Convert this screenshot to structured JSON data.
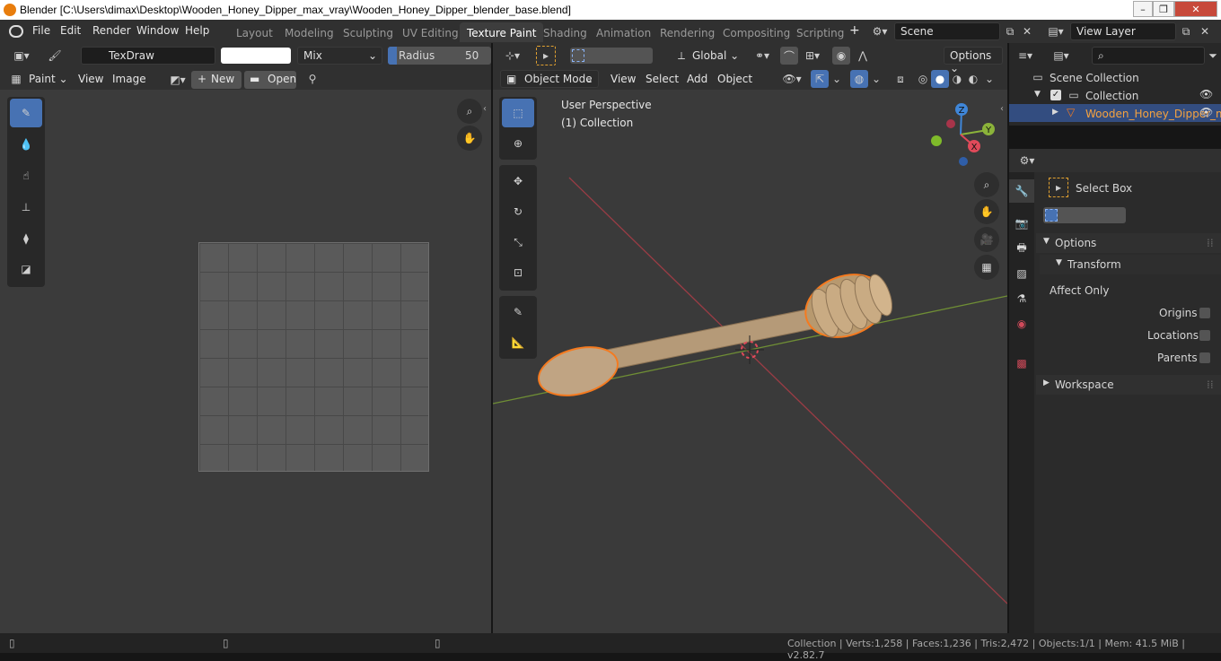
{
  "window": {
    "title": "Blender [C:\\Users\\dimax\\Desktop\\Wooden_Honey_Dipper_max_vray\\Wooden_Honey_Dipper_blender_base.blend]"
  },
  "menu": [
    "File",
    "Edit",
    "Render",
    "Window",
    "Help"
  ],
  "workspaces": [
    "Layout",
    "Modeling",
    "Sculpting",
    "UV Editing",
    "Texture Paint",
    "Shading",
    "Animation",
    "Rendering",
    "Compositing",
    "Scripting"
  ],
  "active_workspace": "Texture Paint",
  "add_workspace": "+",
  "scene": {
    "name": "Scene"
  },
  "view_layer": {
    "name": "View Layer"
  },
  "image_editor": {
    "brush_name": "TexDraw",
    "blend_mode": "Mix",
    "radius_label": "Radius",
    "radius_value": "50 px",
    "mode": "Paint",
    "menus": [
      "View",
      "Image"
    ],
    "new_label": "New",
    "open_label": "Open"
  },
  "viewport": {
    "orientation": "Global",
    "options_label": "Options",
    "mode": "Object Mode",
    "menus": [
      "View",
      "Select",
      "Add",
      "Object"
    ],
    "perspective_label": "User Perspective",
    "collection_label": "(1) Collection",
    "gizmo": {
      "x": "X",
      "y": "Y",
      "z": "Z"
    }
  },
  "outliner": {
    "scene_collection": "Scene Collection",
    "collection": "Collection",
    "object": "Wooden_Honey_Dipper_m"
  },
  "properties": {
    "tool_name": "Select Box",
    "options_label": "Options",
    "transform_label": "Transform",
    "affect_only_label": "Affect Only",
    "origins_label": "Origins",
    "locations_label": "Locations",
    "parents_label": "Parents",
    "workspace_label": "Workspace"
  },
  "status": {
    "text": "Collection | Verts:1,258 | Faces:1,236 | Tris:2,472 | Objects:1/1 | Mem: 41.5 MiB | v2.82.7"
  },
  "colors": {
    "accent": "#4772b3",
    "selection": "#f57a1f",
    "x_axis": "#e04a5a",
    "y_axis": "#8bb33a",
    "z_axis": "#3f86d8"
  }
}
